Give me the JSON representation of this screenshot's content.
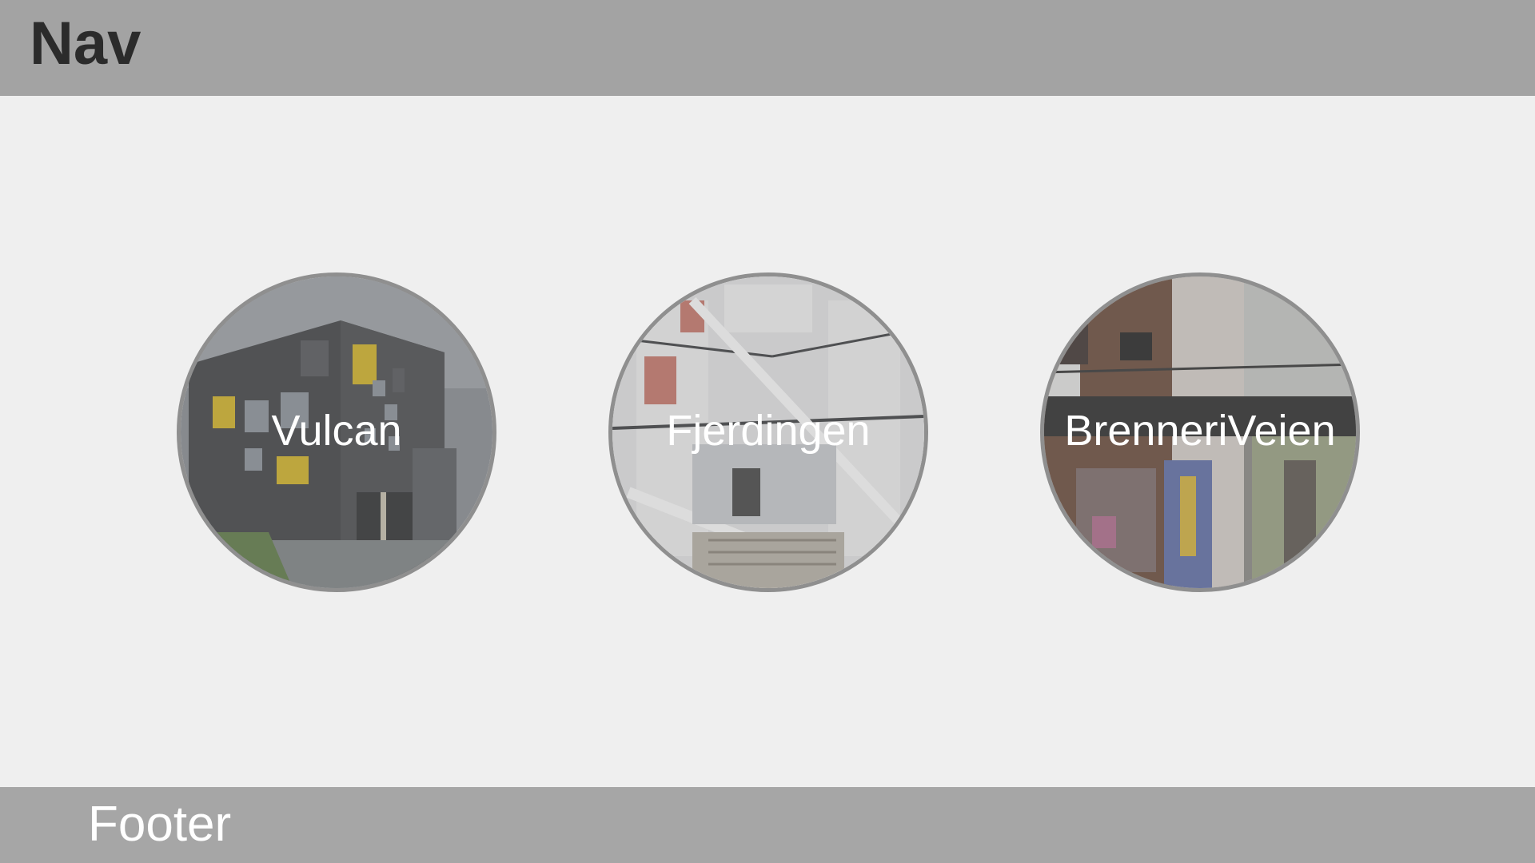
{
  "nav": {
    "title": "Nav"
  },
  "locations": [
    {
      "label": "Vulcan",
      "image": "vulcan-building-photo"
    },
    {
      "label": "Fjerdingen",
      "image": "fjerdingen-atrium-photo"
    },
    {
      "label": "BrenneriVeien",
      "image": "brenneriveien-street-photo"
    }
  ],
  "footer": {
    "text": "Footer"
  },
  "colors": {
    "nav_background": "#a3a3a3",
    "page_background": "#efefef",
    "footer_background": "#a6a6a6",
    "circle_border": "#8f8f8f",
    "label_text": "#ffffff"
  }
}
